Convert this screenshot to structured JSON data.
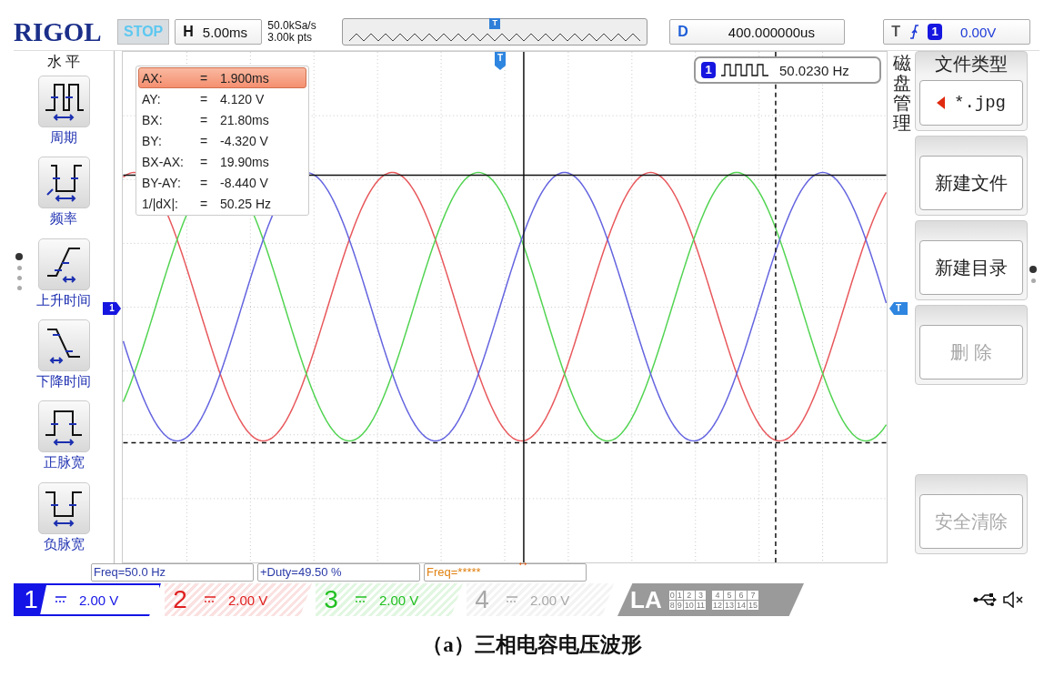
{
  "top_bar": {
    "logo": "RIGOL",
    "run_state": "STOP",
    "horizontal": {
      "label": "H",
      "value": "5.00ms"
    },
    "sample_rate": "50.0kSa/s",
    "memory_depth": "3.00k pts",
    "memory_marker": "T",
    "delay": {
      "label": "D",
      "value": "400.000000us"
    },
    "trigger": {
      "label": "T",
      "source": "1",
      "level": "0.00V"
    }
  },
  "left_menu": {
    "title": "水 平",
    "items": [
      {
        "kind": "period",
        "label": "周期"
      },
      {
        "kind": "frequency",
        "label": "频率"
      },
      {
        "kind": "rise",
        "label": "上升时间"
      },
      {
        "kind": "fall",
        "label": "下降时间"
      },
      {
        "kind": "positive_width",
        "label": "正脉宽"
      },
      {
        "kind": "negative_width",
        "label": "负脉宽"
      }
    ],
    "page_dots": [
      {
        "selected": true
      },
      {
        "selected": false
      },
      {
        "selected": false
      },
      {
        "selected": false
      }
    ]
  },
  "traces": [
    {
      "color": "#e8585c"
    },
    {
      "color": "#52d452"
    },
    {
      "color": "#6464e0"
    }
  ],
  "cursor_readout": [
    {
      "label": "AX:",
      "sign": "=",
      "value": "1.900ms",
      "selected": true
    },
    {
      "label": "AY:",
      "sign": "=",
      "value": "4.120 V",
      "selected": false
    },
    {
      "label": "BX:",
      "sign": "=",
      "value": "21.80ms",
      "selected": false
    },
    {
      "label": "BY:",
      "sign": "=",
      "value": "-4.320 V",
      "selected": false
    },
    {
      "label": "BX-AX:",
      "sign": "=",
      "value": "19.90ms",
      "selected": false
    },
    {
      "label": "BY-AY:",
      "sign": "=",
      "value": "-8.440 V",
      "selected": false
    },
    {
      "label": "1/|dX|:",
      "sign": "=",
      "value": "50.25 Hz",
      "selected": false
    }
  ],
  "frequency_counter": {
    "channel": "1",
    "value": "50.0230 Hz"
  },
  "channel_marker": "1",
  "trigger_level_marker": "T",
  "trigger_position_marker": "T",
  "cursor_position_marker": "↔",
  "side_menu": {
    "title": "磁盘管理",
    "items": [
      {
        "kind": "option",
        "label": "文件类型",
        "value": "*.jpg",
        "disabled": false
      },
      {
        "kind": "action",
        "label": "新建文件",
        "disabled": false
      },
      {
        "kind": "action",
        "label": "新建目录",
        "disabled": false
      },
      {
        "kind": "action",
        "label": "删 除",
        "disabled": true
      },
      {
        "kind": "action",
        "label": "安全清除",
        "disabled": true
      }
    ],
    "page_dots": [
      {
        "selected": true
      },
      {
        "selected": false
      }
    ]
  },
  "measurements": [
    {
      "text": "Freq=50.0 Hz",
      "color": "#2a3aa8"
    },
    {
      "text": "+Duty=49.50 %",
      "color": "#2a3aa8"
    },
    {
      "text": "Freq=*****",
      "color": "#e08010"
    }
  ],
  "channels": [
    {
      "number": "1",
      "scale": "2.00 V",
      "color": "#1414e6",
      "selected": true
    },
    {
      "number": "2",
      "scale": "2.00 V",
      "color": "#e02020",
      "selected": false
    },
    {
      "number": "3",
      "scale": "2.00 V",
      "color": "#22c022",
      "selected": false
    },
    {
      "number": "4",
      "scale": "2.00 V",
      "color": "#a8a8a8",
      "selected": false
    }
  ],
  "logic_analyzer": {
    "label": "LA",
    "bits_row_1": [
      "0",
      "1",
      "2",
      "3",
      "4",
      "5",
      "6",
      "7"
    ],
    "bits_row_2": [
      "8",
      "9",
      "10",
      "11",
      "12",
      "13",
      "14",
      "15"
    ]
  },
  "caption": "（a）三相电容电压波形"
}
